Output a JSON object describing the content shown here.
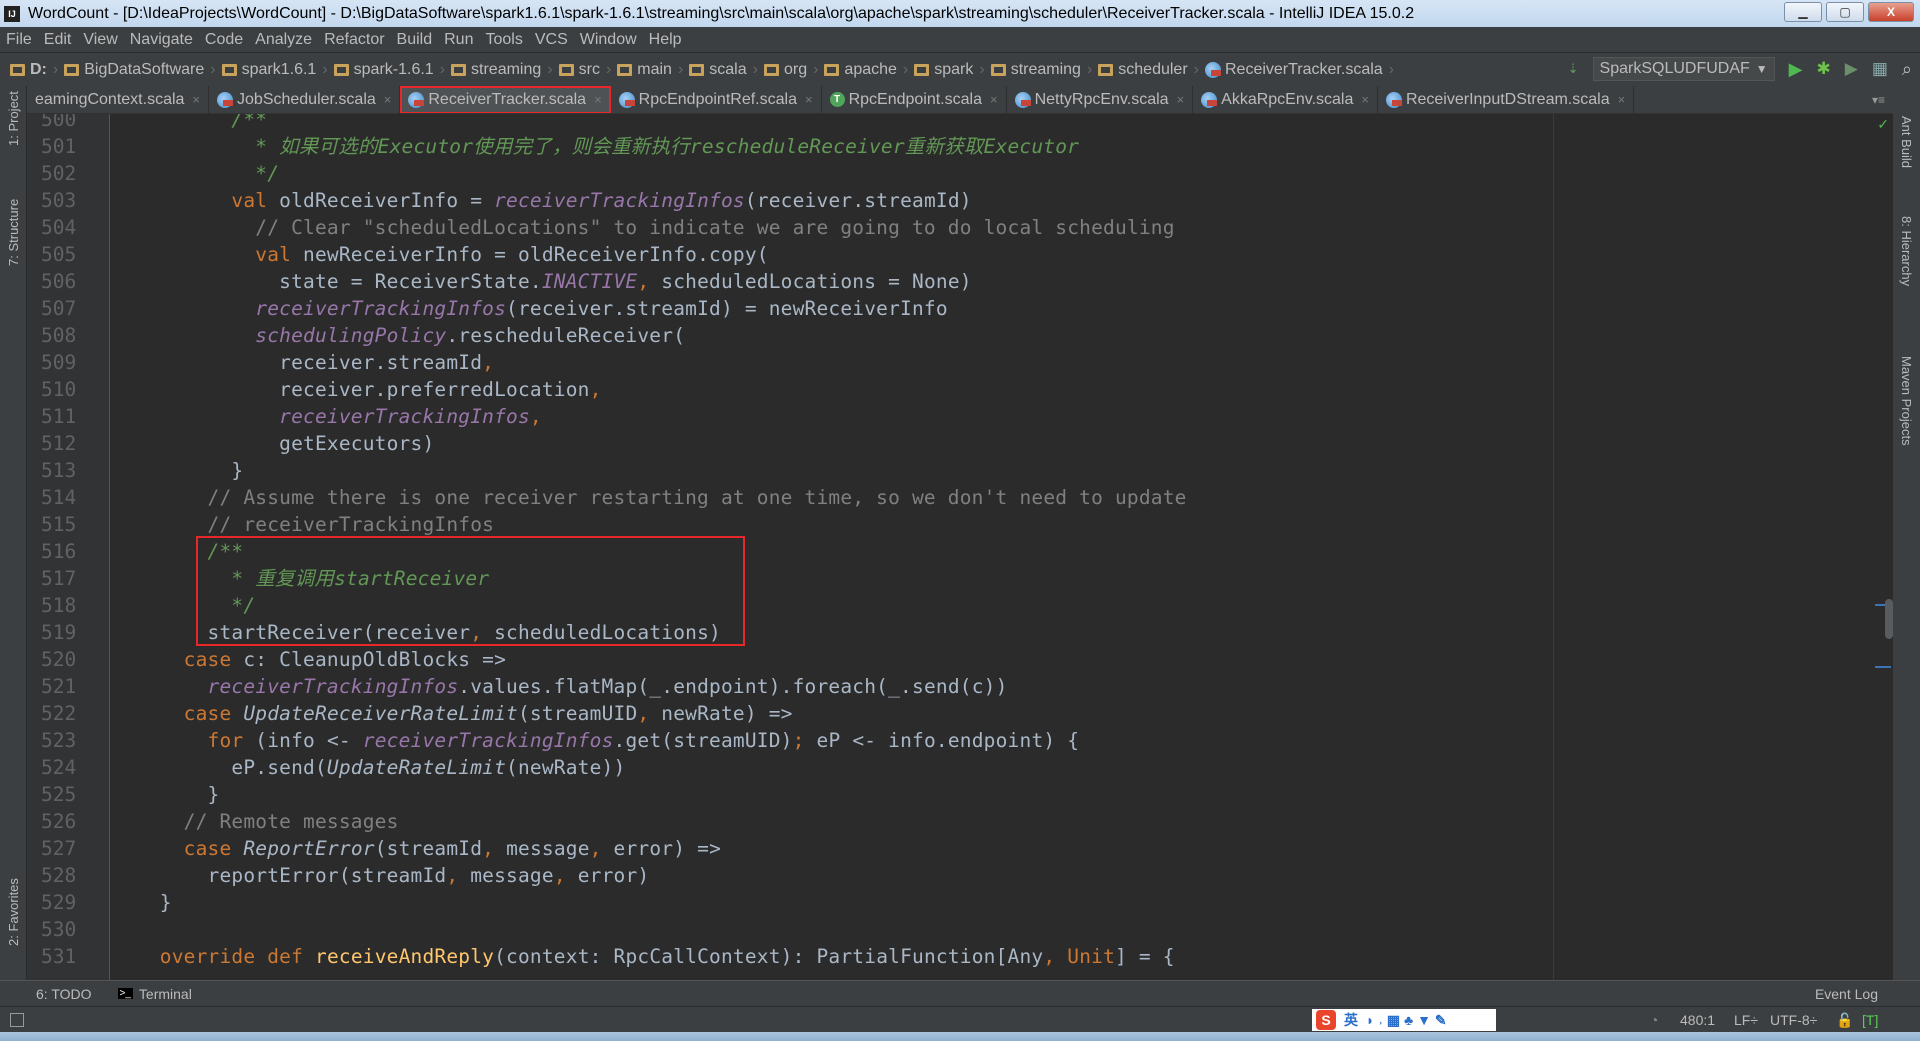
{
  "window": {
    "title": "WordCount - [D:\\IdeaProjects\\WordCount] - D:\\BigDataSoftware\\spark1.6.1\\spark-1.6.1\\streaming\\src\\main\\scala\\org\\apache\\spark\\streaming\\scheduler\\ReceiverTracker.scala - IntelliJ IDEA 15.0.2",
    "app_icon": "IJ",
    "minimize": "▁",
    "maximize": "▢",
    "close": "X"
  },
  "menu": [
    "File",
    "Edit",
    "View",
    "Navigate",
    "Code",
    "Analyze",
    "Refactor",
    "Build",
    "Run",
    "Tools",
    "VCS",
    "Window",
    "Help"
  ],
  "breadcrumbs": [
    "D:",
    "BigDataSoftware",
    "spark1.6.1",
    "spark-1.6.1",
    "streaming",
    "src",
    "main",
    "scala",
    "org",
    "apache",
    "spark",
    "streaming",
    "scheduler",
    "ReceiverTracker.scala"
  ],
  "run_config": {
    "name": "SparkSQLUDFUDAF",
    "arrow": "▼"
  },
  "tabs": [
    {
      "label": "eamingContext.scala",
      "icon": "scala-class-icon",
      "active": false
    },
    {
      "label": "JobScheduler.scala",
      "icon": "scala-class-icon",
      "active": false
    },
    {
      "label": "ReceiverTracker.scala",
      "icon": "scala-class-icon",
      "active": true
    },
    {
      "label": "RpcEndpointRef.scala",
      "icon": "scala-class-icon",
      "active": false
    },
    {
      "label": "RpcEndpoint.scala",
      "icon": "scala-trait-icon",
      "active": false
    },
    {
      "label": "NettyRpcEnv.scala",
      "icon": "scala-class-icon",
      "active": false
    },
    {
      "label": "AkkaRpcEnv.scala",
      "icon": "scala-class-icon",
      "active": false
    },
    {
      "label": "ReceiverInputDStream.scala",
      "icon": "scala-class-icon",
      "active": false
    }
  ],
  "tab_close": "×",
  "trait_letter": "T",
  "tab_menu": "▾≡",
  "left_tools": [
    "1: Project",
    "7: Structure",
    "2: Favorites"
  ],
  "right_tools": [
    "Ant Build",
    "8: Hierarchy",
    "Maven Projects"
  ],
  "code_lines": [
    {
      "n": "500",
      "t": [
        [
          "          /**",
          "doc"
        ]
      ]
    },
    {
      "n": "501",
      "t": [
        [
          "            * 如果可选的Executor使用完了，则会重新执行rescheduleReceiver重新获取Executor",
          "doc"
        ]
      ]
    },
    {
      "n": "502",
      "t": [
        [
          "            */",
          "doc"
        ]
      ]
    },
    {
      "n": "503",
      "t": [
        [
          "          ",
          ""
        ],
        [
          "val",
          "kw"
        ],
        [
          " oldReceiverInfo = ",
          ""
        ],
        [
          "receiverTrackingInfos",
          "fld"
        ],
        [
          "(receiver.streamId)",
          ""
        ]
      ]
    },
    {
      "n": "504",
      "t": [
        [
          "            // Clear \"scheduledLocations\" to indicate we are going to do local scheduling",
          "cm"
        ]
      ]
    },
    {
      "n": "505",
      "t": [
        [
          "            ",
          ""
        ],
        [
          "val",
          "kw"
        ],
        [
          " newReceiverInfo = oldReceiverInfo.copy(",
          ""
        ]
      ]
    },
    {
      "n": "506",
      "t": [
        [
          "              state = ReceiverState.",
          ""
        ],
        [
          "INACTIVE",
          "fld"
        ],
        [
          ",",
          "kw"
        ],
        [
          " scheduledLocations = None)",
          ""
        ]
      ]
    },
    {
      "n": "507",
      "t": [
        [
          "            ",
          ""
        ],
        [
          "receiverTrackingInfos",
          "fld"
        ],
        [
          "(receiver.streamId) = newReceiverInfo",
          ""
        ]
      ]
    },
    {
      "n": "508",
      "t": [
        [
          "            ",
          ""
        ],
        [
          "schedulingPolicy",
          "fld"
        ],
        [
          ".rescheduleReceiver(",
          ""
        ]
      ]
    },
    {
      "n": "509",
      "t": [
        [
          "              receiver.streamId",
          ""
        ],
        [
          ",",
          "kw"
        ]
      ]
    },
    {
      "n": "510",
      "t": [
        [
          "              receiver.preferredLocation",
          ""
        ],
        [
          ",",
          "kw"
        ]
      ]
    },
    {
      "n": "511",
      "t": [
        [
          "              ",
          ""
        ],
        [
          "receiverTrackingInfos",
          "fld"
        ],
        [
          ",",
          "kw"
        ]
      ]
    },
    {
      "n": "512",
      "t": [
        [
          "              getExecutors)",
          ""
        ]
      ]
    },
    {
      "n": "513",
      "t": [
        [
          "          }",
          ""
        ]
      ]
    },
    {
      "n": "514",
      "t": [
        [
          "        // Assume there is one receiver restarting at one time, so we don't need to update",
          "cm"
        ]
      ]
    },
    {
      "n": "515",
      "t": [
        [
          "        // receiverTrackingInfos",
          "cm"
        ]
      ]
    },
    {
      "n": "516",
      "t": [
        [
          "        /**",
          "doc"
        ]
      ]
    },
    {
      "n": "517",
      "t": [
        [
          "          * 重复调用startReceiver",
          "doc"
        ]
      ]
    },
    {
      "n": "518",
      "t": [
        [
          "          */",
          "doc"
        ]
      ]
    },
    {
      "n": "519",
      "t": [
        [
          "        startReceiver(receiver",
          ""
        ],
        [
          ",",
          "kw"
        ],
        [
          " scheduledLocations)",
          ""
        ]
      ]
    },
    {
      "n": "520",
      "t": [
        [
          "      ",
          ""
        ],
        [
          "case",
          "kw"
        ],
        [
          " c: CleanupOldBlocks =>",
          ""
        ]
      ]
    },
    {
      "n": "521",
      "t": [
        [
          "        ",
          ""
        ],
        [
          "receiverTrackingInfos",
          "fld"
        ],
        [
          ".values.flatMap(_.endpoint).foreach(_.send(c))",
          ""
        ]
      ]
    },
    {
      "n": "522",
      "t": [
        [
          "      ",
          ""
        ],
        [
          "case",
          "kw"
        ],
        [
          " ",
          ""
        ],
        [
          "UpdateReceiverRateLimit",
          "it"
        ],
        [
          "(streamUID",
          ""
        ],
        [
          ",",
          "kw"
        ],
        [
          " newRate) =>",
          ""
        ]
      ]
    },
    {
      "n": "523",
      "t": [
        [
          "        ",
          ""
        ],
        [
          "for",
          "kw"
        ],
        [
          " (info <- ",
          ""
        ],
        [
          "receiverTrackingInfos",
          "fld"
        ],
        [
          ".get(streamUID)",
          ""
        ],
        [
          ";",
          "kw"
        ],
        [
          " eP <- info.endpoint) {",
          ""
        ]
      ]
    },
    {
      "n": "524",
      "t": [
        [
          "          eP.send(",
          ""
        ],
        [
          "UpdateRateLimit",
          "it"
        ],
        [
          "(newRate))",
          ""
        ]
      ]
    },
    {
      "n": "525",
      "t": [
        [
          "        }",
          ""
        ]
      ]
    },
    {
      "n": "526",
      "t": [
        [
          "      // Remote messages",
          "cm"
        ]
      ]
    },
    {
      "n": "527",
      "t": [
        [
          "      ",
          ""
        ],
        [
          "case",
          "kw"
        ],
        [
          " ",
          ""
        ],
        [
          "ReportError",
          "it"
        ],
        [
          "(streamId",
          ""
        ],
        [
          ",",
          "kw"
        ],
        [
          " message",
          ""
        ],
        [
          ",",
          "kw"
        ],
        [
          " error) =>",
          ""
        ]
      ]
    },
    {
      "n": "528",
      "t": [
        [
          "        reportError(streamId",
          ""
        ],
        [
          ",",
          "kw"
        ],
        [
          " message",
          ""
        ],
        [
          ",",
          "kw"
        ],
        [
          " error)",
          ""
        ]
      ]
    },
    {
      "n": "529",
      "t": [
        [
          "    }",
          ""
        ]
      ]
    },
    {
      "n": "530",
      "t": []
    },
    {
      "n": "531",
      "t": [
        [
          "    ",
          ""
        ],
        [
          "override def",
          "kw"
        ],
        [
          " ",
          ""
        ],
        [
          "receiveAndReply",
          "fn"
        ],
        [
          "(context: RpcCallContext): PartialFunction[Any",
          ""
        ],
        [
          ",",
          "kw"
        ],
        [
          " ",
          ""
        ],
        [
          "Unit",
          "kw"
        ],
        [
          "] = {",
          ""
        ]
      ]
    }
  ],
  "bottom_tools": {
    "todo": "6: TODO",
    "terminal": "Terminal",
    "event_log": "Event Log"
  },
  "status": {
    "position": "480:1",
    "line_sep": "LF÷",
    "encoding": "UTF-8÷"
  },
  "ime": {
    "logo": "S",
    "lang": "英",
    "symbols": "◗ ˒ ▦ ♣ ▼ ✎"
  },
  "colors": {
    "highlight": "#e8272a",
    "keyword": "#cc7832",
    "comment": "#808080",
    "doc": "#629755",
    "field": "#9876aa",
    "text": "#a9b7c6",
    "function": "#ffc66d"
  }
}
